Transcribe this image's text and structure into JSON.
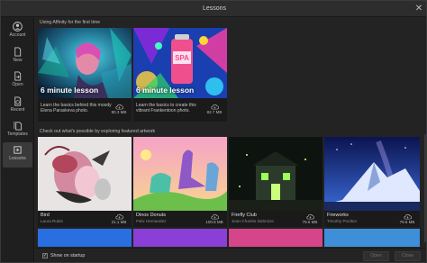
{
  "window": {
    "title": "Lessons",
    "close_glyph": "✕"
  },
  "sidebar": {
    "items": [
      {
        "label": "Account",
        "icon": "account-icon"
      },
      {
        "label": "New",
        "icon": "new-document-icon"
      },
      {
        "label": "Open",
        "icon": "open-folder-icon"
      },
      {
        "label": "Recent",
        "icon": "recent-clock-icon"
      },
      {
        "label": "Templates",
        "icon": "templates-icon"
      },
      {
        "label": "Lessons",
        "icon": "lessons-icon",
        "active": true
      }
    ]
  },
  "lessons_section": {
    "title": "Using Affinity for the first time",
    "cards": [
      {
        "badge": "6 minute lesson",
        "description": "Learn the basics behind this moody Elena Paraskeva photo.",
        "size": "80.3 MB"
      },
      {
        "badge": "6 minute lesson",
        "description": "Learn the basics to create this vibrant Frankentoon photo.",
        "size": "82.7 MB"
      }
    ]
  },
  "artwork_section": {
    "title": "Check out what's possible by exploring featured artwork",
    "cards": [
      {
        "name": "Bird",
        "author": "Laura Rubin",
        "size": "21.1 MB"
      },
      {
        "name": "Dinos Donuts",
        "author": "Felix Hernandez",
        "size": "100.8 MB"
      },
      {
        "name": "Firefly Club",
        "author": "Jean-Charles Debroize",
        "size": "79.6 MB"
      },
      {
        "name": "Fireworks",
        "author": "Timothy Poulton",
        "size": "79.6 MB"
      }
    ]
  },
  "footer": {
    "show_on_startup_label": "Show on startup",
    "show_on_startup_checked": true,
    "checkmark": "✓",
    "open_label": "Open",
    "close_label": "Close"
  },
  "colors": {
    "accent": "#4aa3df",
    "panel": "#232323",
    "sidebar": "#1f1f1f"
  }
}
